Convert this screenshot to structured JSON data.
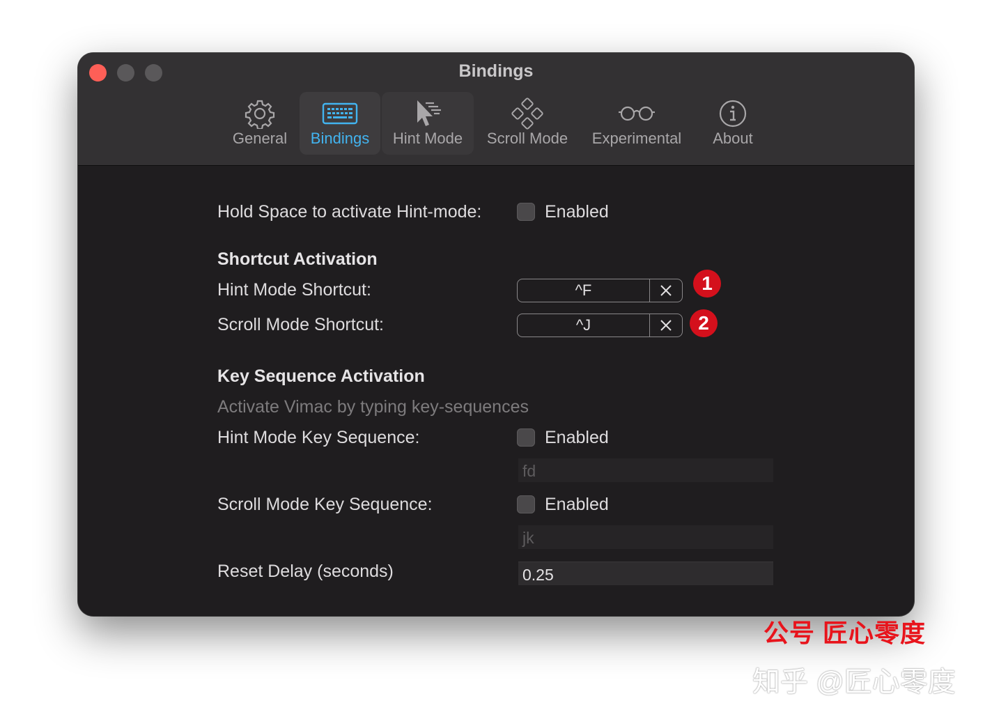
{
  "window": {
    "title": "Bindings"
  },
  "toolbar": {
    "tabs": [
      {
        "label": "General",
        "icon": "gear-icon"
      },
      {
        "label": "Bindings",
        "icon": "keyboard-icon"
      },
      {
        "label": "Hint Mode",
        "icon": "cursor-hint-icon"
      },
      {
        "label": "Scroll Mode",
        "icon": "gamepad-icon"
      },
      {
        "label": "Experimental",
        "icon": "glasses-icon"
      },
      {
        "label": "About",
        "icon": "info-icon"
      }
    ],
    "selected": "Bindings",
    "accent_color": "#42b4f0"
  },
  "hold_space": {
    "label": "Hold Space to activate Hint-mode:",
    "checkbox_label": "Enabled",
    "checked": false
  },
  "shortcut_activation": {
    "heading": "Shortcut Activation",
    "hint": {
      "label": "Hint Mode Shortcut:",
      "value": "^F",
      "badge": "1"
    },
    "scroll": {
      "label": "Scroll Mode Shortcut:",
      "value": "^J",
      "badge": "2"
    }
  },
  "key_sequence": {
    "heading": "Key Sequence Activation",
    "description": "Activate Vimac by typing key-sequences",
    "hint": {
      "label": "Hint Mode Key Sequence:",
      "checkbox_label": "Enabled",
      "checked": false,
      "value": "fd"
    },
    "scroll": {
      "label": "Scroll Mode Key Sequence:",
      "checkbox_label": "Enabled",
      "checked": false,
      "value": "jk"
    },
    "reset": {
      "label": "Reset Delay (seconds)",
      "value": "0.25"
    }
  },
  "watermarks": {
    "red": "公号  匠心零度",
    "gray": "知乎 @匠心零度"
  },
  "colors": {
    "badge": "#d4101c",
    "close_button": "#fe5f57"
  }
}
